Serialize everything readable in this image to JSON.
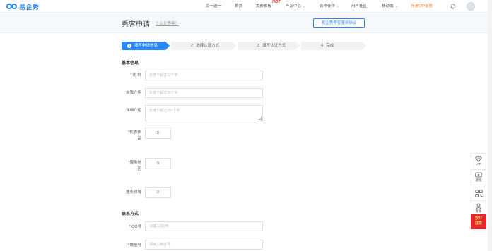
{
  "brand": {
    "name": "易企秀",
    "color": "#2b86f5"
  },
  "nav": {
    "items": [
      {
        "label": "买一送一",
        "dropdown": false
      },
      {
        "label": "首页",
        "dropdown": false
      },
      {
        "label": "免费模板",
        "dropdown": false,
        "badge": "HOT"
      },
      {
        "label": "产品中心",
        "dropdown": true
      },
      {
        "label": "合作伙伴",
        "dropdown": true
      },
      {
        "label": "用户社区",
        "dropdown": false
      },
      {
        "label": "移动端",
        "dropdown": true
      },
      {
        "label": "开通VIP会员",
        "dropdown": false,
        "highlight": true
      }
    ],
    "bell_icon": "bell-icon",
    "avatar_icon": "avatar"
  },
  "header": {
    "title": "秀客申请",
    "help_link": "什么是秀客？",
    "agreement_button": "易企秀秀客服务协议"
  },
  "steps": [
    {
      "number": "1",
      "label": "填写申请信息",
      "active": true
    },
    {
      "number": "2",
      "label": "选择认证方式",
      "active": false
    },
    {
      "number": "3",
      "label": "填写认证方式",
      "active": false
    },
    {
      "number": "4",
      "label": "完成",
      "active": false
    }
  ],
  "basic_info": {
    "section_title": "基本信息",
    "nickname": {
      "label": "昵 称",
      "required": true,
      "placeholder": "长度不超过12个字"
    },
    "intro": {
      "label": "自我介绍",
      "required": false,
      "placeholder": "长度不超过30个字"
    },
    "detail": {
      "label": "详细介绍",
      "required": false,
      "placeholder": "长度不超过200个字"
    },
    "works": {
      "label_line1": "代表作",
      "label_line2": "品",
      "required": true,
      "value": "0"
    },
    "region": {
      "label_line1": "服务地",
      "label_line2": "区",
      "required": true,
      "value": "0"
    },
    "skill": {
      "label": "擅长领域",
      "required": false,
      "value": "0"
    }
  },
  "contact": {
    "section_title": "联系方式",
    "qq": {
      "label": "QQ号",
      "required": true,
      "placeholder": "请输入QQ号"
    },
    "wechat": {
      "label": "微信号",
      "required": true,
      "placeholder": "请输入微信号"
    }
  },
  "sidebar": {
    "items": [
      {
        "label": "VIP",
        "icon": "vip-diamond-icon"
      },
      {
        "label": "教程",
        "icon": "video-tutorial-icon"
      },
      {
        "label": "",
        "icon": "qr-code-icon"
      },
      {
        "label": "客服",
        "icon": "customer-service-icon"
      }
    ],
    "promo": {
      "line1": "双11",
      "line2": "狂欢"
    }
  },
  "colors": {
    "accent": "#2b86f5",
    "required": "#e7382f",
    "vip": "#ff7a21",
    "promo_bg": "#e6262f"
  }
}
